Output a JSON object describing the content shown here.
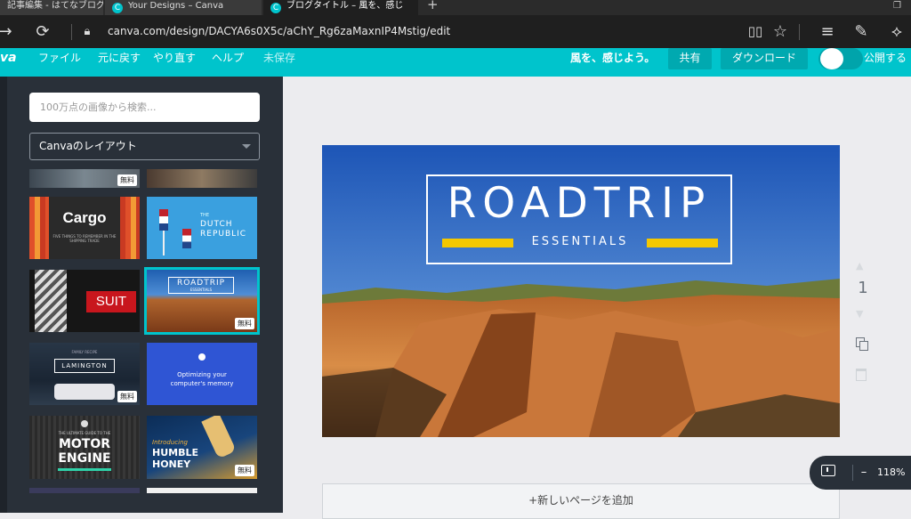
{
  "browser": {
    "tabs": [
      {
        "title": "記事編集 - はてなブログ",
        "active": false
      },
      {
        "title": "Your Designs – Canva",
        "active": false
      },
      {
        "title": "ブログタイトル – 風を、感じ",
        "active": true
      }
    ],
    "new_tab_glyph": "+",
    "url": "canva.com/design/DACYA6s0X5c/aChY_Rg6zaMaxnIP4Mstig/edit"
  },
  "menubar": {
    "logo_fragment": "va",
    "items": [
      "ファイル",
      "元に戻す",
      "やり直す",
      "ヘルプ",
      "未保存"
    ],
    "design_title": "風を、感じよう。",
    "share_label": "共有",
    "download_label": "ダウンロード",
    "publish_label": "公開する",
    "accent_color": "#00c4cc"
  },
  "sidebar": {
    "search_placeholder": "100万点の画像から検索...",
    "layout_select_value": "Canvaのレイアウト",
    "free_badge": "無料",
    "thumbs": {
      "cargo": {
        "title": "Cargo",
        "subtitle": "FIVE THINGS TO REMEMBER IN THE SHIPPING TRADE"
      },
      "dutch": {
        "small": "THE",
        "title1": "DUTCH",
        "title2": "REPUBLIC"
      },
      "suit": {
        "title": "SUIT"
      },
      "roadtrip": {
        "title": "ROADTRIP",
        "subtitle": "ESSENTIALS"
      },
      "lamington": {
        "top": "FAMILY RECIPE",
        "title": "LAMINGTON"
      },
      "optimizing": {
        "line1": "Optimizing your",
        "line2": "computer's memory"
      },
      "motor": {
        "top": "THE ULTIMATE GUIDE TO THE",
        "title1": "MOTOR",
        "title2": "ENGINE"
      },
      "honey": {
        "intro": "Introducing",
        "title1": "HUMBLE",
        "title2": "HONEY"
      }
    }
  },
  "design": {
    "title": "ROADTRIP",
    "subtitle": "ESSENTIALS",
    "accent_bar_color": "#f5c800"
  },
  "page_number": "1",
  "add_page_label": "+新しいページを追加",
  "zoom": {
    "level": "118%",
    "minus": "–"
  }
}
